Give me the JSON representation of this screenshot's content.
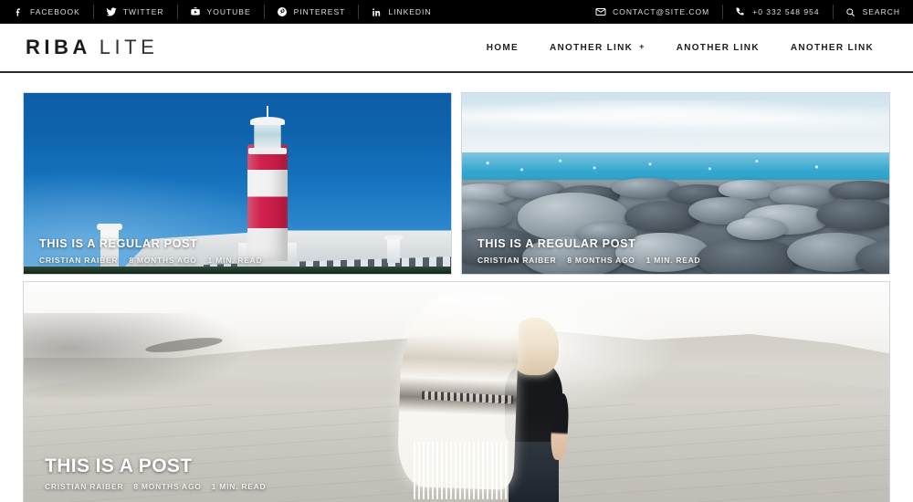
{
  "topbar": {
    "social": [
      {
        "label": "FACEBOOK",
        "icon": "facebook-icon"
      },
      {
        "label": "TWITTER",
        "icon": "twitter-icon"
      },
      {
        "label": "YOUTUBE",
        "icon": "youtube-icon"
      },
      {
        "label": "PINTEREST",
        "icon": "pinterest-icon"
      },
      {
        "label": "LINKEDIN",
        "icon": "linkedin-icon"
      }
    ],
    "contact": [
      {
        "label": "CONTACT@SITE.COM",
        "icon": "mail-icon"
      },
      {
        "label": "+0 332 548 954",
        "icon": "phone-icon"
      },
      {
        "label": "SEARCH",
        "icon": "search-icon"
      }
    ],
    "background": "#000000",
    "text_color": "#dcdcdc"
  },
  "header": {
    "logo_primary": "RIBA",
    "logo_secondary": "LITE",
    "nav": [
      {
        "label": "HOME",
        "has_dropdown": false
      },
      {
        "label": "ANOTHER LINK",
        "has_dropdown": true,
        "caret": "+"
      },
      {
        "label": "ANOTHER LINK",
        "has_dropdown": false
      },
      {
        "label": "ANOTHER LINK",
        "has_dropdown": false
      }
    ]
  },
  "posts": [
    {
      "title": "THIS IS A REGULAR POST",
      "author": "CRISTIAN RAIBER",
      "date": "8 MONTHS AGO",
      "read_time": "1 MIN. READ",
      "image": "lighthouse-red-white-stripes-blue-sky",
      "size": "half"
    },
    {
      "title": "THIS IS A REGULAR POST",
      "author": "CRISTIAN RAIBER",
      "date": "8 MONTHS AGO",
      "read_time": "1 MIN. READ",
      "image": "grey-pebbles-beach-turquoise-sea",
      "size": "half"
    },
    {
      "title": "THIS IS A POST",
      "author": "CRISTIAN RAIBER",
      "date": "8 MONTHS AGO",
      "read_time": "1 MIN. READ",
      "image": "woman-with-scarf-on-sand-dunes",
      "size": "full"
    }
  ]
}
